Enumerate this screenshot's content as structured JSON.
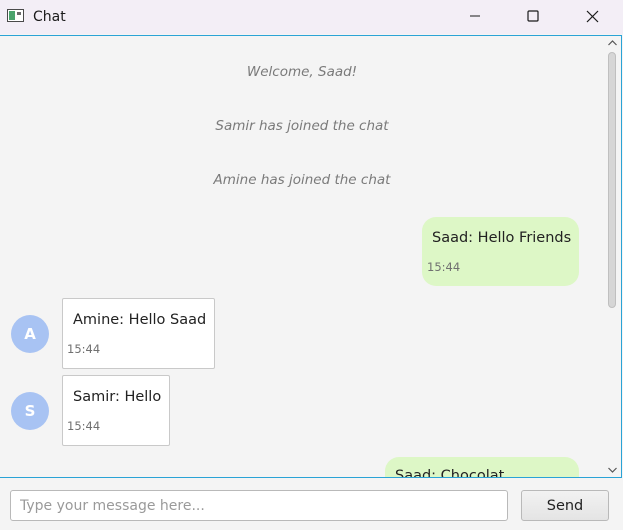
{
  "window": {
    "title": "Chat"
  },
  "chat": {
    "system_messages": [
      "Welcome, Saad!",
      "Samir has joined the chat",
      "Amine has joined the chat"
    ],
    "messages": [
      {
        "sender": "Saad",
        "text": "Saad: Hello Friends",
        "time": "15:44",
        "own": true
      },
      {
        "sender": "Amine",
        "avatar": "A",
        "text": "Amine: Hello Saad",
        "time": "15:44",
        "own": false
      },
      {
        "sender": "Samir",
        "avatar": "S",
        "text": "Samir: Hello",
        "time": "15:44",
        "own": false
      },
      {
        "sender": "Saad",
        "text": "Saad: Chocolat...",
        "time": "",
        "own": true
      }
    ],
    "colors": {
      "own_bubble": "#ddf7c6",
      "other_bubble": "#ffffff",
      "avatar": "#a8c3f3",
      "focus_border": "#2aa3d6"
    }
  },
  "composer": {
    "placeholder": "Type your message here...",
    "value": "",
    "send_label": "Send"
  },
  "icons": {
    "app": "chat-window-icon",
    "minimize": "minimize-icon",
    "maximize": "maximize-icon",
    "close": "close-icon",
    "scroll_up": "chevron-up-icon",
    "scroll_down": "chevron-down-icon"
  }
}
